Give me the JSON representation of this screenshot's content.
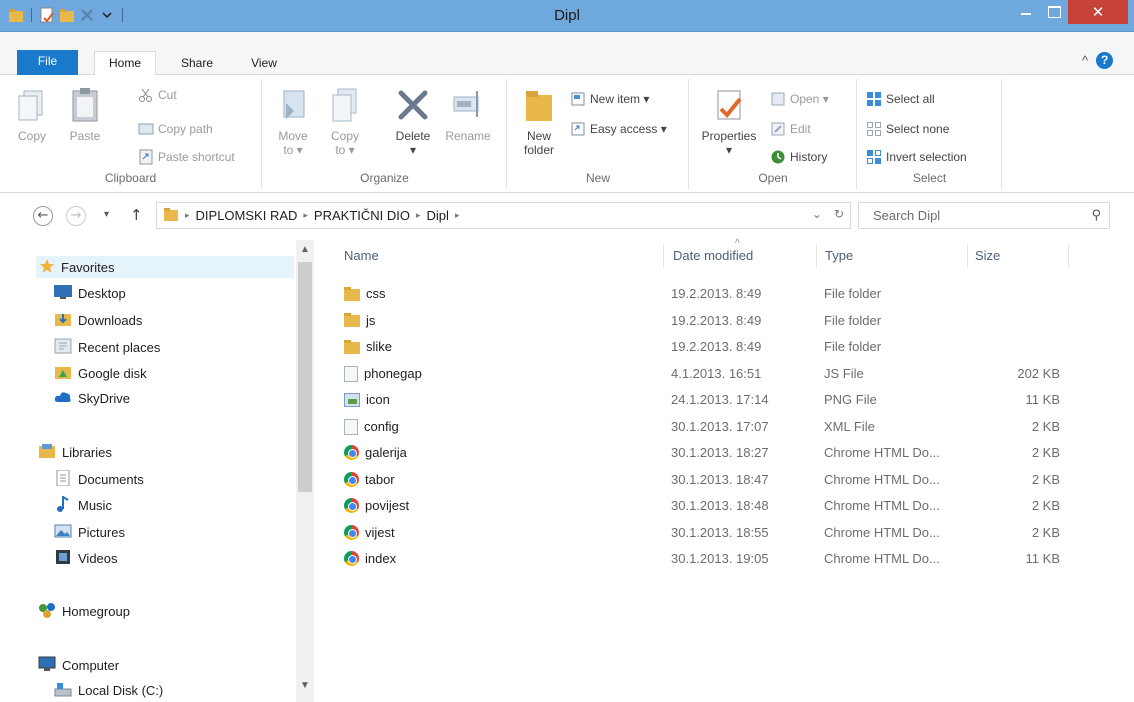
{
  "window": {
    "title": "Dipl",
    "close_glyph": "✕"
  },
  "ribbon_tabs": {
    "file": "File",
    "home": "Home",
    "share": "Share",
    "view": "View",
    "collapse_glyph": "^",
    "help_glyph": "?"
  },
  "clipboard": {
    "copy": "Copy",
    "paste": "Paste",
    "cut": "Cut",
    "copy_path": "Copy path",
    "paste_shortcut": "Paste shortcut",
    "label": "Clipboard"
  },
  "organize": {
    "move_to": "Move",
    "move_to_sub": "to ▾",
    "copy_to": "Copy",
    "copy_to_sub": "to ▾",
    "delete": "Delete",
    "delete_sub": "▾",
    "rename": "Rename",
    "label": "Organize"
  },
  "new": {
    "new_folder": "New",
    "new_folder_sub": "folder",
    "new_item": "New item ▾",
    "easy_access": "Easy access ▾",
    "label": "New"
  },
  "open": {
    "properties": "Properties",
    "properties_sub": "▾",
    "open": "Open ▾",
    "edit": "Edit",
    "history": "History",
    "label": "Open"
  },
  "select": {
    "select_all": "Select all",
    "select_none": "Select none",
    "invert": "Invert selection",
    "label": "Select"
  },
  "nav": {
    "back": "←",
    "forward": "→",
    "recent": "▾",
    "up": "↑",
    "breadcrumb": [
      "DIPLOMSKI RAD",
      "PRAKTIČNI DIO",
      "Dipl"
    ],
    "crumb_sep": "▸",
    "dropdown": "⌄",
    "refresh": "↻",
    "search_placeholder": "Search Dipl",
    "search_glyph": "⚲"
  },
  "sidebar": {
    "favorites": "Favorites",
    "favorites_items": [
      "Desktop",
      "Downloads",
      "Recent places",
      "Google disk",
      "SkyDrive"
    ],
    "libraries": "Libraries",
    "libraries_items": [
      "Documents",
      "Music",
      "Pictures",
      "Videos"
    ],
    "homegroup": "Homegroup",
    "computer": "Computer",
    "computer_items": [
      "Local Disk (C:)"
    ],
    "scroll_up": "▲",
    "scroll_down": "▼"
  },
  "columns": {
    "name": "Name",
    "date": "Date modified",
    "type": "Type",
    "size": "Size",
    "sort_glyph": "^"
  },
  "files": [
    {
      "name": "css",
      "date": "19.2.2013. 8:49",
      "type": "File folder",
      "size": "",
      "icon": "folder-icon"
    },
    {
      "name": "js",
      "date": "19.2.2013. 8:49",
      "type": "File folder",
      "size": "",
      "icon": "folder-icon"
    },
    {
      "name": "slike",
      "date": "19.2.2013. 8:49",
      "type": "File folder",
      "size": "",
      "icon": "folder-icon"
    },
    {
      "name": "phonegap",
      "date": "4.1.2013. 16:51",
      "type": "JS File",
      "size": "202 KB",
      "icon": "file-icon"
    },
    {
      "name": "icon",
      "date": "24.1.2013. 17:14",
      "type": "PNG File",
      "size": "11 KB",
      "icon": "png-icon"
    },
    {
      "name": "config",
      "date": "30.1.2013. 17:07",
      "type": "XML File",
      "size": "2 KB",
      "icon": "file-icon"
    },
    {
      "name": "galerija",
      "date": "30.1.2013. 18:27",
      "type": "Chrome HTML Do...",
      "size": "2 KB",
      "icon": "chrome-icon"
    },
    {
      "name": "tabor",
      "date": "30.1.2013. 18:47",
      "type": "Chrome HTML Do...",
      "size": "2 KB",
      "icon": "chrome-icon"
    },
    {
      "name": "povijest",
      "date": "30.1.2013. 18:48",
      "type": "Chrome HTML Do...",
      "size": "2 KB",
      "icon": "chrome-icon"
    },
    {
      "name": "vijest",
      "date": "30.1.2013. 18:55",
      "type": "Chrome HTML Do...",
      "size": "2 KB",
      "icon": "chrome-icon"
    },
    {
      "name": "index",
      "date": "30.1.2013. 19:05",
      "type": "Chrome HTML Do...",
      "size": "11 KB",
      "icon": "chrome-icon"
    }
  ],
  "colors": {
    "titlebar": "#6fa8dc",
    "accent": "#1979ca",
    "close": "#c7433a",
    "folder": "#e8b94a"
  }
}
